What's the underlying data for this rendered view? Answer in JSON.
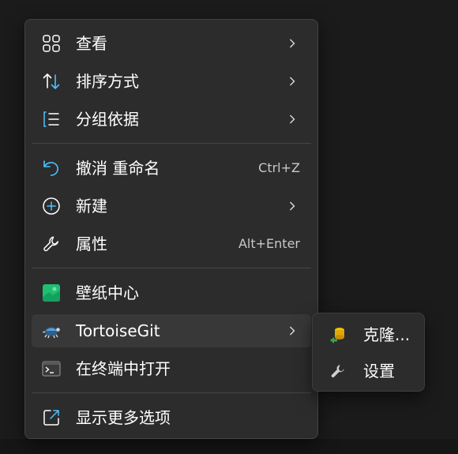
{
  "menu": {
    "items": [
      {
        "label": "查看",
        "icon": "grid-icon",
        "submenu": true
      },
      {
        "label": "排序方式",
        "icon": "sort-icon",
        "submenu": true
      },
      {
        "label": "分组依据",
        "icon": "group-list-icon",
        "submenu": true
      },
      {
        "label": "撤消 重命名",
        "icon": "undo-icon",
        "shortcut": "Ctrl+Z"
      },
      {
        "label": "新建",
        "icon": "add-circle-icon",
        "submenu": true
      },
      {
        "label": "属性",
        "icon": "wrench-icon",
        "shortcut": "Alt+Enter"
      },
      {
        "label": "壁纸中心",
        "icon": "wallpaper-icon"
      },
      {
        "label": "TortoiseGit",
        "icon": "tortoisegit-icon",
        "submenu": true,
        "hovered": true
      },
      {
        "label": "在终端中打开",
        "icon": "terminal-icon"
      },
      {
        "label": "显示更多选项",
        "icon": "share-icon"
      }
    ]
  },
  "submenu": {
    "items": [
      {
        "label": "克隆...",
        "icon": "clone-icon"
      },
      {
        "label": "设置",
        "icon": "settings-wrench-icon"
      }
    ]
  },
  "colors": {
    "menu_bg": "#2c2c2c",
    "hover_bg": "#383838",
    "accent": "#4cc2ff",
    "text": "#ffffff",
    "shortcut_text": "#c8c8c8"
  }
}
